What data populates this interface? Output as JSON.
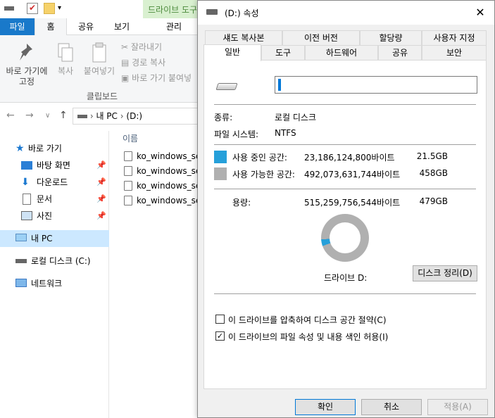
{
  "explorer": {
    "context_tab_title": "드라이브 도구",
    "menu": {
      "file": "파일",
      "home": "홈",
      "share": "공유",
      "view": "보기",
      "manage": "관리"
    },
    "ribbon": {
      "pin_label": "바로 가기에\n고정",
      "copy_label": "복사",
      "paste_label": "붙여넣기",
      "cut_label": "잘라내기",
      "copy_path_label": "경로 복사",
      "paste_shortcut_label": "바로 가기 붙여넣",
      "group_label": "클립보드"
    },
    "address": {
      "pc": "내 PC",
      "separator": ">",
      "drive": "(D:)"
    },
    "nav_pane": {
      "quick_access": "바로 가기",
      "desktop": "바탕 화면",
      "downloads": "다운로드",
      "documents": "문서",
      "pictures": "사진",
      "this_pc": "내 PC",
      "local_disk": "로컬 디스크 (C:)",
      "network": "네트워크"
    },
    "file_list": {
      "column_name": "이름",
      "files": [
        "ko_windows_ser",
        "ko_windows_ser",
        "ko_windows_ser",
        "ko_windows_ser"
      ]
    }
  },
  "dialog": {
    "title": "(D:) 속성",
    "tabs_row1": [
      "섀도 복사본",
      "이전 버전",
      "할당량",
      "사용자 지정"
    ],
    "tabs_row2": [
      "일반",
      "도구",
      "하드웨어",
      "공유",
      "보안"
    ],
    "type_label": "종류:",
    "type_value": "로컬 디스크",
    "fs_label": "파일 시스템:",
    "fs_value": "NTFS",
    "used_label": "사용 중인 공간:",
    "used_bytes": "23,186,124,800바이트",
    "used_gb": "21.5GB",
    "free_label": "사용 가능한 공간:",
    "free_bytes": "492,073,631,744바이트",
    "free_gb": "458GB",
    "capacity_label": "용량:",
    "capacity_bytes": "515,259,756,544바이트",
    "capacity_gb": "479GB",
    "drive_label": "드라이브 D:",
    "cleanup_button": "디스크 정리(D)",
    "compress_label": "이 드라이브를 압축하여 디스크 공간 절약(C)",
    "compress_checked": false,
    "index_label": "이 드라이브의 파일 속성 및 내용 색인 허용(I)",
    "index_checked": true,
    "ok_button": "확인",
    "cancel_button": "취소",
    "apply_button": "적용(A)",
    "used_fraction": 0.045,
    "colors": {
      "used": "#26a0da",
      "free": "#b0b0b0"
    }
  }
}
